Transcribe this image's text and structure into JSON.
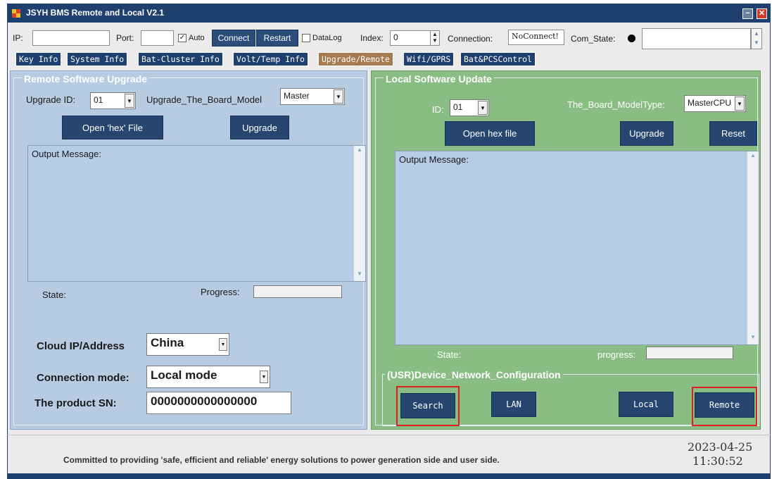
{
  "window": {
    "title": "JSYH BMS Remote and Local V2.1",
    "min_glyph": "−",
    "close_glyph": "✕",
    "colors": {
      "titlebar": "#1f3f6e",
      "left_panel": "#b7cbe2",
      "right_panel": "#8abd84",
      "active_tab": "#a57a4f",
      "highlight": "#e02020"
    }
  },
  "toolbar": {
    "ip_label": "IP:",
    "ip_value": "",
    "port_label": "Port:",
    "port_value": "",
    "auto_checked": true,
    "auto_label": "Auto",
    "connect_label": "Connect",
    "restart_label": "Restart",
    "datalog_checked": false,
    "datalog_label": "DataLog",
    "index_label": "Index:",
    "index_value": "0",
    "connection_label": "Connection:",
    "connection_value": "NoConnect!",
    "com_state_label": "Com_State:",
    "com_state_value": ""
  },
  "tabs": [
    {
      "label": "Key Info",
      "active": false
    },
    {
      "label": "System Info",
      "active": false
    },
    {
      "label": "Bat-Cluster Info",
      "active": false
    },
    {
      "label": "Volt/Temp Info",
      "active": false
    },
    {
      "label": "Upgrade/Remote",
      "active": true
    },
    {
      "label": "Wifi/GPRS",
      "active": false
    },
    {
      "label": "Bat&PCSControl",
      "active": false
    }
  ],
  "remote": {
    "title": "Remote Software Upgrade",
    "upgrade_id_label": "Upgrade ID:",
    "upgrade_id_value": "01",
    "board_model_label": "Upgrade_The_Board_Model",
    "board_model_value": "Master",
    "open_hex_label": "Open 'hex' File",
    "upgrade_label": "Upgrade",
    "output_label": "Output Message:",
    "state_label": "State:",
    "progress_label": "Progress:",
    "progress_value": 0,
    "cloud_label": "Cloud IP/Address",
    "cloud_value": "China",
    "conn_mode_label": "Connection mode:",
    "conn_mode_value": "Local mode",
    "sn_label": "The product SN:",
    "sn_value": "0000000000000000"
  },
  "local": {
    "title": "Local Software Update",
    "id_label": "ID:",
    "id_value": "01",
    "board_type_label": "The_Board_ModelType:",
    "board_type_value": "MasterCPU",
    "open_hex_label": "Open hex file",
    "upgrade_label": "Upgrade",
    "reset_label": "Reset",
    "output_label": "Output Message:",
    "state_label": "State:",
    "progress_label": "progress:",
    "progress_value": 0
  },
  "usr": {
    "title": "(USR)Device_Network_Configuration",
    "search_label": "Search",
    "lan_label": "LAN",
    "local_label": "Local",
    "remote_label": "Remote"
  },
  "footer": {
    "slogan": "Committed to providing 'safe, efficient and reliable' energy solutions to power generation side and user side.",
    "date": "2023-04-25",
    "time": "11:30:52"
  }
}
